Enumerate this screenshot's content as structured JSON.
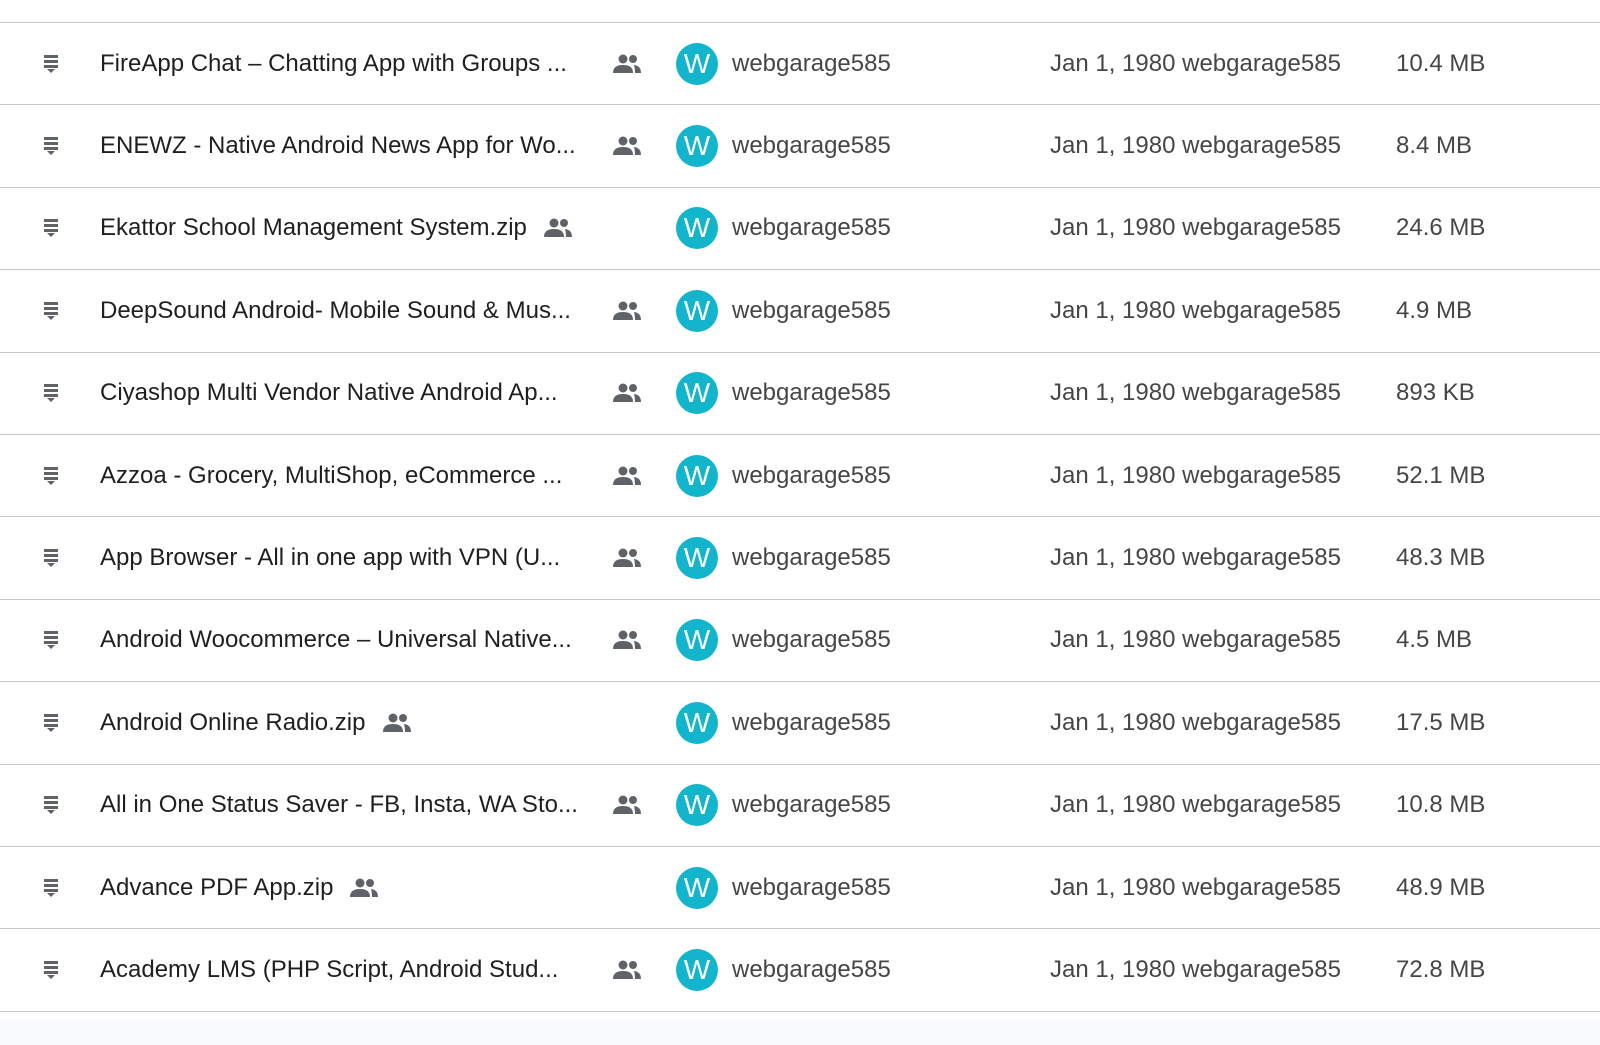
{
  "colors": {
    "avatar_bg": "#12b5cb",
    "divider": "#c7c7c7",
    "icon_gray": "#5f6368"
  },
  "icons": {
    "file": "zip-file-icon",
    "shared": "people-icon"
  },
  "files": [
    {
      "name": "FireApp Chat – Chatting App with Groups ...",
      "truncated": true,
      "avatar_letter": "W",
      "owner": "webgarage585",
      "modified": "Jan 1, 1980",
      "modified_by": "webgarage585",
      "size": "10.4 MB"
    },
    {
      "name": "ENEWZ - Native Android News App for Wo...",
      "truncated": true,
      "avatar_letter": "W",
      "owner": "webgarage585",
      "modified": "Jan 1, 1980",
      "modified_by": "webgarage585",
      "size": "8.4 MB"
    },
    {
      "name": "Ekattor School Management System.zip",
      "truncated": false,
      "avatar_letter": "W",
      "owner": "webgarage585",
      "modified": "Jan 1, 1980",
      "modified_by": "webgarage585",
      "size": "24.6 MB"
    },
    {
      "name": "DeepSound Android- Mobile Sound & Mus...",
      "truncated": true,
      "avatar_letter": "W",
      "owner": "webgarage585",
      "modified": "Jan 1, 1980",
      "modified_by": "webgarage585",
      "size": "4.9 MB"
    },
    {
      "name": "Ciyashop Multi Vendor Native Android Ap...",
      "truncated": true,
      "avatar_letter": "W",
      "owner": "webgarage585",
      "modified": "Jan 1, 1980",
      "modified_by": "webgarage585",
      "size": "893 KB"
    },
    {
      "name": "Azzoa - Grocery, MultiShop, eCommerce ...",
      "truncated": true,
      "avatar_letter": "W",
      "owner": "webgarage585",
      "modified": "Jan 1, 1980",
      "modified_by": "webgarage585",
      "size": "52.1 MB"
    },
    {
      "name": "App Browser - All in one app with VPN (U...",
      "truncated": true,
      "avatar_letter": "W",
      "owner": "webgarage585",
      "modified": "Jan 1, 1980",
      "modified_by": "webgarage585",
      "size": "48.3 MB"
    },
    {
      "name": "Android Woocommerce – Universal Native...",
      "truncated": true,
      "avatar_letter": "W",
      "owner": "webgarage585",
      "modified": "Jan 1, 1980",
      "modified_by": "webgarage585",
      "size": "4.5 MB"
    },
    {
      "name": "Android Online Radio.zip",
      "truncated": false,
      "avatar_letter": "W",
      "owner": "webgarage585",
      "modified": "Jan 1, 1980",
      "modified_by": "webgarage585",
      "size": "17.5 MB"
    },
    {
      "name": "All in One Status Saver - FB, Insta, WA Sto...",
      "truncated": true,
      "avatar_letter": "W",
      "owner": "webgarage585",
      "modified": "Jan 1, 1980",
      "modified_by": "webgarage585",
      "size": "10.8 MB"
    },
    {
      "name": "Advance PDF App.zip",
      "truncated": false,
      "avatar_letter": "W",
      "owner": "webgarage585",
      "modified": "Jan 1, 1980",
      "modified_by": "webgarage585",
      "size": "48.9 MB"
    },
    {
      "name": "Academy LMS  (PHP Script, Android Stud...",
      "truncated": true,
      "avatar_letter": "W",
      "owner": "webgarage585",
      "modified": "Jan 1, 1980",
      "modified_by": "webgarage585",
      "size": "72.8 MB"
    }
  ]
}
